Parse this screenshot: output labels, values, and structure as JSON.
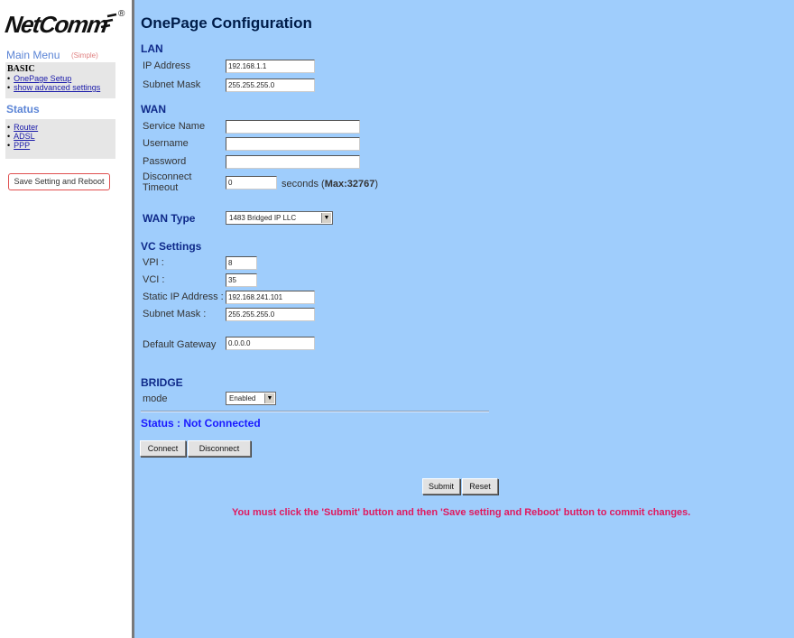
{
  "sidebar": {
    "logo_text": "NetComm",
    "logo_reg": "®",
    "main_menu": "Main Menu",
    "main_menu_mode": "(Simple)",
    "basic": {
      "title": "BASIC",
      "items": [
        {
          "label": "OnePage Setup"
        },
        {
          "label": "show advanced settings"
        }
      ]
    },
    "status": {
      "title": "Status",
      "items": [
        {
          "label": "Router"
        },
        {
          "label": "ADSL"
        },
        {
          "label": "PPP"
        }
      ]
    },
    "save_reboot": "Save Setting and Reboot"
  },
  "main": {
    "title": "OnePage Configuration",
    "lan": {
      "title": "LAN",
      "ip_label": "IP Address",
      "ip_value": "192.168.1.1",
      "mask_label": "Subnet Mask",
      "mask_value": "255.255.255.0"
    },
    "wan": {
      "title": "WAN",
      "service_label": "Service Name",
      "service_value": "",
      "username_label": "Username",
      "username_value": "",
      "password_label": "Password",
      "password_value": "",
      "timeout_label_1": "Disconnect",
      "timeout_label_2": "Timeout",
      "timeout_value": "0",
      "timeout_suffix": "seconds (",
      "timeout_max": "Max:32767",
      "timeout_close": ")"
    },
    "wan_type": {
      "label": "WAN Type",
      "selected": "1483 Bridged IP LLC"
    },
    "vc": {
      "title": "VC Settings",
      "vpi_label": "VPI :",
      "vpi_value": "8",
      "vci_label": "VCI :",
      "vci_value": "35",
      "static_ip_label": "Static IP Address :",
      "static_ip_value": "192.168.241.101",
      "mask_label": "Subnet Mask :",
      "mask_value": "255.255.255.0",
      "gateway_label": "Default Gateway",
      "gateway_value": "0.0.0.0"
    },
    "bridge": {
      "title": "BRIDGE",
      "mode_label": "mode",
      "mode_selected": "Enabled"
    },
    "status_text": "Status : Not Connected",
    "connect_label": "Connect",
    "disconnect_label": "Disconnect",
    "submit_label": "Submit",
    "reset_label": "Reset",
    "warning": "You must click the 'Submit' button and then 'Save setting and Reboot' button to commit changes."
  },
  "icons": {
    "logo": "netcomm-logo-mark",
    "dropdown": "chevron-down-icon"
  },
  "colors": {
    "background": "#9fcdfc",
    "heading": "#0f2a8a",
    "status": "#1a1aff",
    "warning": "#e0185e",
    "sidebar_heading": "#5c85d6"
  }
}
